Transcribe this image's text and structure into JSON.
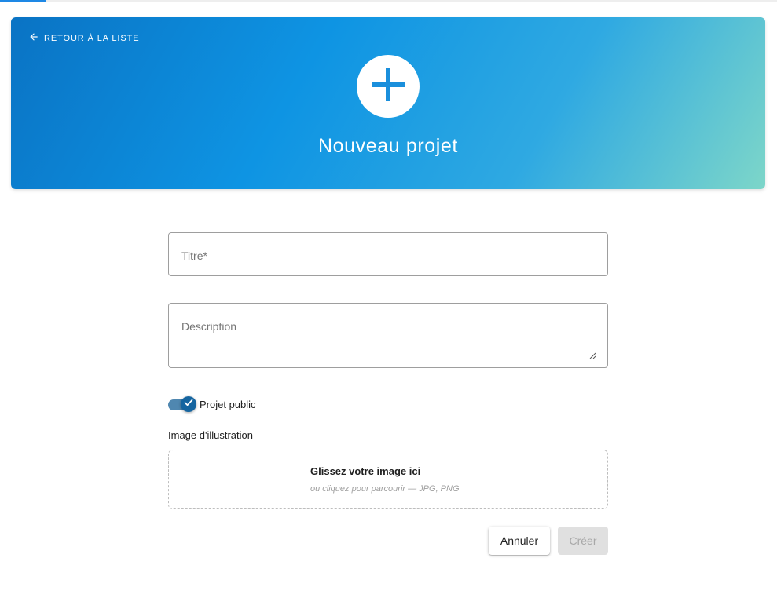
{
  "colors": {
    "hero_gradient_start": "#0a73c4",
    "hero_gradient_end": "#7dd6c9",
    "toggle_track": "#4f87b0",
    "toggle_knob": "#1565a0",
    "progress": "#1e88e5",
    "disabled_button": "#e0e0e0"
  },
  "header": {
    "back_label": "RETOUR À LA LISTE",
    "back_icon": "arrow-left-icon",
    "main_icon": "plus-icon",
    "title": "Nouveau projet"
  },
  "form": {
    "title_placeholder": "Titre*",
    "description_placeholder": "Description",
    "public_toggle": {
      "label": "Projet public",
      "checked": true
    },
    "image": {
      "label": "Image d'illustration",
      "drop_main": "Glissez votre image ici",
      "drop_sub": "ou cliquez pour parcourir — JPG, PNG"
    }
  },
  "actions": {
    "cancel_label": "Annuler",
    "create_label": "Créer",
    "create_disabled": true
  }
}
